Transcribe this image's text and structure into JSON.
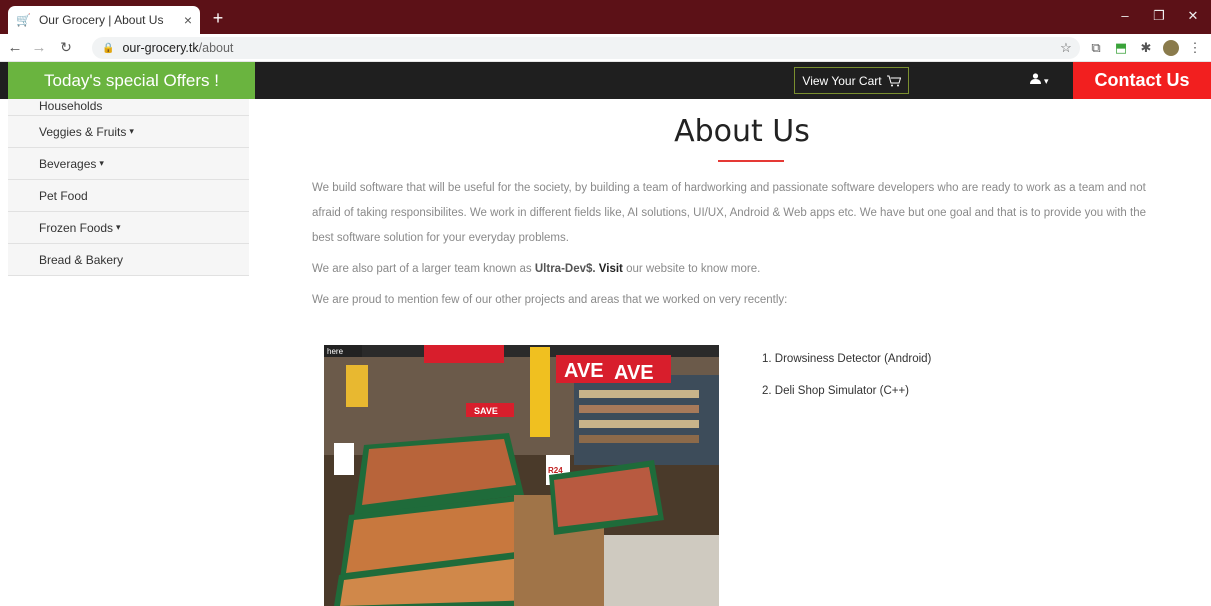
{
  "browser": {
    "tab_title": "Our Grocery | About Us",
    "tab_close": "×",
    "new_tab": "+",
    "url_host": "our-grocery.tk",
    "url_path": "/about",
    "window_controls": [
      "–",
      "❐",
      "✕"
    ],
    "nav_icons": [
      "back-icon",
      "forward-icon",
      "reload-icon"
    ]
  },
  "topnav": {
    "offers": "Today's special Offers !",
    "cart": "View Your Cart",
    "contact": "Contact Us"
  },
  "sidebar": {
    "items": [
      {
        "label": "Households",
        "caret": false
      },
      {
        "label": "Veggies & Fruits",
        "caret": true
      },
      {
        "label": "Beverages",
        "caret": true
      },
      {
        "label": "Pet Food",
        "caret": false
      },
      {
        "label": "Frozen Foods",
        "caret": true
      },
      {
        "label": "Bread & Bakery",
        "caret": false
      }
    ]
  },
  "main": {
    "heading": "About Us",
    "paragraph1": "We build software that will be useful for the society, by building a team of hardworking and passionate software developers who are ready to work as a team and not afraid of taking responsibilites. We work in different fields like, AI solutions, UI/UX, Android & Web apps etc. We have but one goal and that is to provide you with the best software solution for your everyday problems.",
    "paragraph2_prefix": "We are also part of a larger team known as ",
    "paragraph2_team": "Ultra-Dev$.",
    "paragraph2_link": "Visit",
    "paragraph2_suffix": " our website to know more.",
    "paragraph3": "We are proud to mention few of our other projects and areas that we worked on very recently:",
    "projects": [
      "1. Drowsiness Detector (Android)",
      "2. Deli Shop Simulator (C++)"
    ],
    "photo_signs": [
      "here",
      "SAVE",
      "AVE",
      "AVE",
      "SAVE",
      "R24"
    ]
  }
}
